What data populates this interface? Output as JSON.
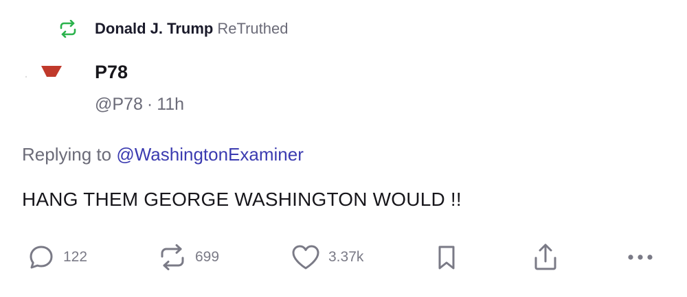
{
  "retruth_banner": {
    "user": "Donald J. Trump",
    "label": "ReTruthed",
    "icon": "retruth-icon",
    "icon_color": "#2bb24c"
  },
  "post": {
    "display_name": "P78",
    "handle": "@P78",
    "separator": "·",
    "time": "11h",
    "avatar_color": "#c0392b",
    "replying_prefix": "Replying to",
    "replying_to": "@WashingtonExaminer",
    "text": "HANG THEM GEORGE WASHINGTON WOULD !!"
  },
  "actions": {
    "reply": {
      "icon": "reply-icon",
      "count": "122"
    },
    "retruth": {
      "icon": "retruth-icon",
      "count": "699"
    },
    "like": {
      "icon": "heart-icon",
      "count": "3.37k"
    },
    "bookmark": {
      "icon": "bookmark-icon"
    },
    "share": {
      "icon": "share-icon"
    },
    "more": {
      "icon": "more-icon"
    }
  },
  "colors": {
    "text_primary": "#17161b",
    "text_secondary": "#6b6b78",
    "mention": "#3b3bb0",
    "action_gray": "#7a7a86"
  }
}
